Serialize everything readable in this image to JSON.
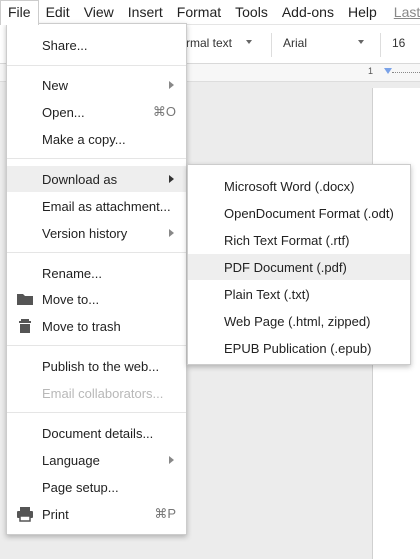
{
  "menubar": {
    "items": [
      "File",
      "Edit",
      "View",
      "Insert",
      "Format",
      "Tools",
      "Add-ons",
      "Help"
    ],
    "active": "File",
    "last_edit": "Last"
  },
  "toolbar": {
    "style_label": "rmal text",
    "font_label": "Arial",
    "size_label": "16"
  },
  "ruler": {
    "tick": "1"
  },
  "file_menu": {
    "share": "Share...",
    "new": "New",
    "open": "Open...",
    "open_shortcut": "⌘O",
    "make_copy": "Make a copy...",
    "download_as": "Download as",
    "email_attachment": "Email as attachment...",
    "version_history": "Version history",
    "rename": "Rename...",
    "move_to": "Move to...",
    "move_to_trash": "Move to trash",
    "publish": "Publish to the web...",
    "email_collaborators": "Email collaborators...",
    "document_details": "Document details...",
    "language": "Language",
    "page_setup": "Page setup...",
    "print": "Print",
    "print_shortcut": "⌘P"
  },
  "download_menu": {
    "items": [
      "Microsoft Word (.docx)",
      "OpenDocument Format (.odt)",
      "Rich Text Format (.rtf)",
      "PDF Document (.pdf)",
      "Plain Text (.txt)",
      "Web Page (.html, zipped)",
      "EPUB Publication (.epub)"
    ],
    "highlighted": "PDF Document (.pdf)"
  },
  "colors": {
    "highlight": "#eeeeee",
    "disabled_text": "#b8b8b8",
    "ruler_marker": "#7aa2e8"
  },
  "icons": {
    "move_to": "folder-icon",
    "move_to_trash": "trash-icon",
    "print": "printer-icon",
    "submenu": "chevron-right-icon"
  }
}
